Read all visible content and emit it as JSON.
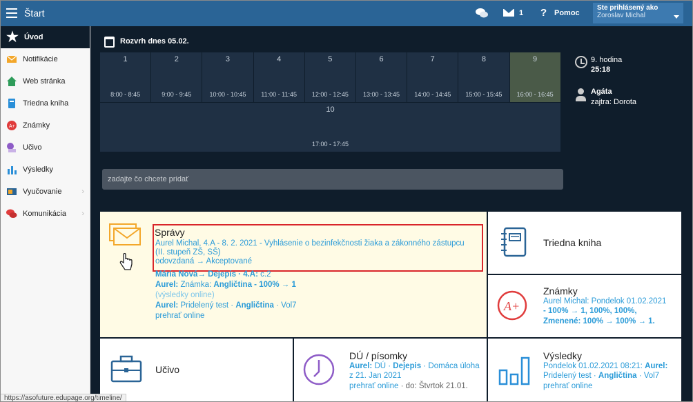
{
  "topbar": {
    "title": "Štart",
    "mail_count": "1",
    "help_label": "Pomoc",
    "user_label": "Ste prihlásený ako",
    "user_name": "Zoroslav Michal"
  },
  "sidebar": {
    "items": [
      {
        "label": "Úvod",
        "icon": "star-icon"
      },
      {
        "label": "Notifikácie",
        "icon": "envelope-icon"
      },
      {
        "label": "Web stránka",
        "icon": "house-icon"
      },
      {
        "label": "Triedna kniha",
        "icon": "book-icon"
      },
      {
        "label": "Známky",
        "icon": "grade-icon"
      },
      {
        "label": "Učivo",
        "icon": "curriculum-icon"
      },
      {
        "label": "Výsledky",
        "icon": "bar-chart-icon"
      },
      {
        "label": "Vyučovanie",
        "icon": "teaching-icon"
      },
      {
        "label": "Komunikácia",
        "icon": "chat-icon"
      }
    ]
  },
  "timetable": {
    "title": "Rozvrh dnes 05.02.",
    "lessons": [
      {
        "num": "1",
        "time": "8:00 - 8:45"
      },
      {
        "num": "2",
        "time": "9:00 - 9:45"
      },
      {
        "num": "3",
        "time": "10:00 - 10:45"
      },
      {
        "num": "4",
        "time": "11:00 - 11:45"
      },
      {
        "num": "5",
        "time": "12:00 - 12:45"
      },
      {
        "num": "6",
        "time": "13:00 - 13:45"
      },
      {
        "num": "7",
        "time": "14:00 - 14:45"
      },
      {
        "num": "8",
        "time": "15:00 - 15:45"
      },
      {
        "num": "9",
        "time": "16:00 - 16:45"
      },
      {
        "num": "10",
        "time": "17:00 - 17:45"
      }
    ],
    "now_lesson": "9. hodina",
    "now_time": "25:18",
    "duty_name": "Agáta",
    "duty_next": "zajtra: Dorota"
  },
  "quick_add": {
    "placeholder": "zadajte čo chcete pridať"
  },
  "messages": {
    "title": "Správy",
    "highlight": {
      "line1": "Aurel Michal, 4.A - 8. 2. 2021 - Vyhlásenie o bezinfekčnosti žiaka a zákonného zástupcu",
      "line2": "(II. stupeň ZŠ, SŠ)",
      "line3": "odovzdaná → Akceptované"
    },
    "item2": {
      "name": "Mária Nová",
      "arrow": "→",
      "subject": "Dejepis · 4.A:",
      "rest": "c.2"
    },
    "item3": {
      "who": "Aurel:",
      "kind": "Známka:",
      "subject": "Angličtina - 100% → 1",
      "note": "(výsledky online)"
    },
    "item4": {
      "who": "Aurel:",
      "kind": "Pridelený test ·",
      "subject": "Angličtina",
      "rest": "· Vol7",
      "link": "prehrať online"
    }
  },
  "class_book": {
    "title": "Triedna kniha"
  },
  "grades": {
    "title": "Známky",
    "line1": "Aurel Michal: Pondelok 01.02.2021",
    "line2": "- 100% → 1, 100%, 100%,",
    "line3a": "Zmenené:",
    "line3b": "100% → 100% → 1."
  },
  "curriculum": {
    "title": "Učivo"
  },
  "homework": {
    "title": "DÚ / písomky",
    "who": "Aurel:",
    "kind": "DÚ ·",
    "subject": "Dejepis",
    "rest": "· Domáca úloha z 21. Jan 2021",
    "link": "prehrať online",
    "due": "· do: Štvrtok 21.01."
  },
  "results": {
    "title": "Výsledky",
    "line1a": "Pondelok 01.02.2021 08:21:",
    "line1b": "Aurel:",
    "line2a": "Pridelený test ·",
    "line2b": "Angličtina",
    "line2c": "· Vol7",
    "link": "prehrať online"
  },
  "status_url": "https://asofuture.edupage.org/timeline/",
  "colors": {
    "topbar": "#2a6496",
    "dark_bg": "#0f1d2b",
    "link": "#2a9bd8",
    "highlight_border": "#d9252a",
    "current_lesson": "#4a5a48"
  }
}
